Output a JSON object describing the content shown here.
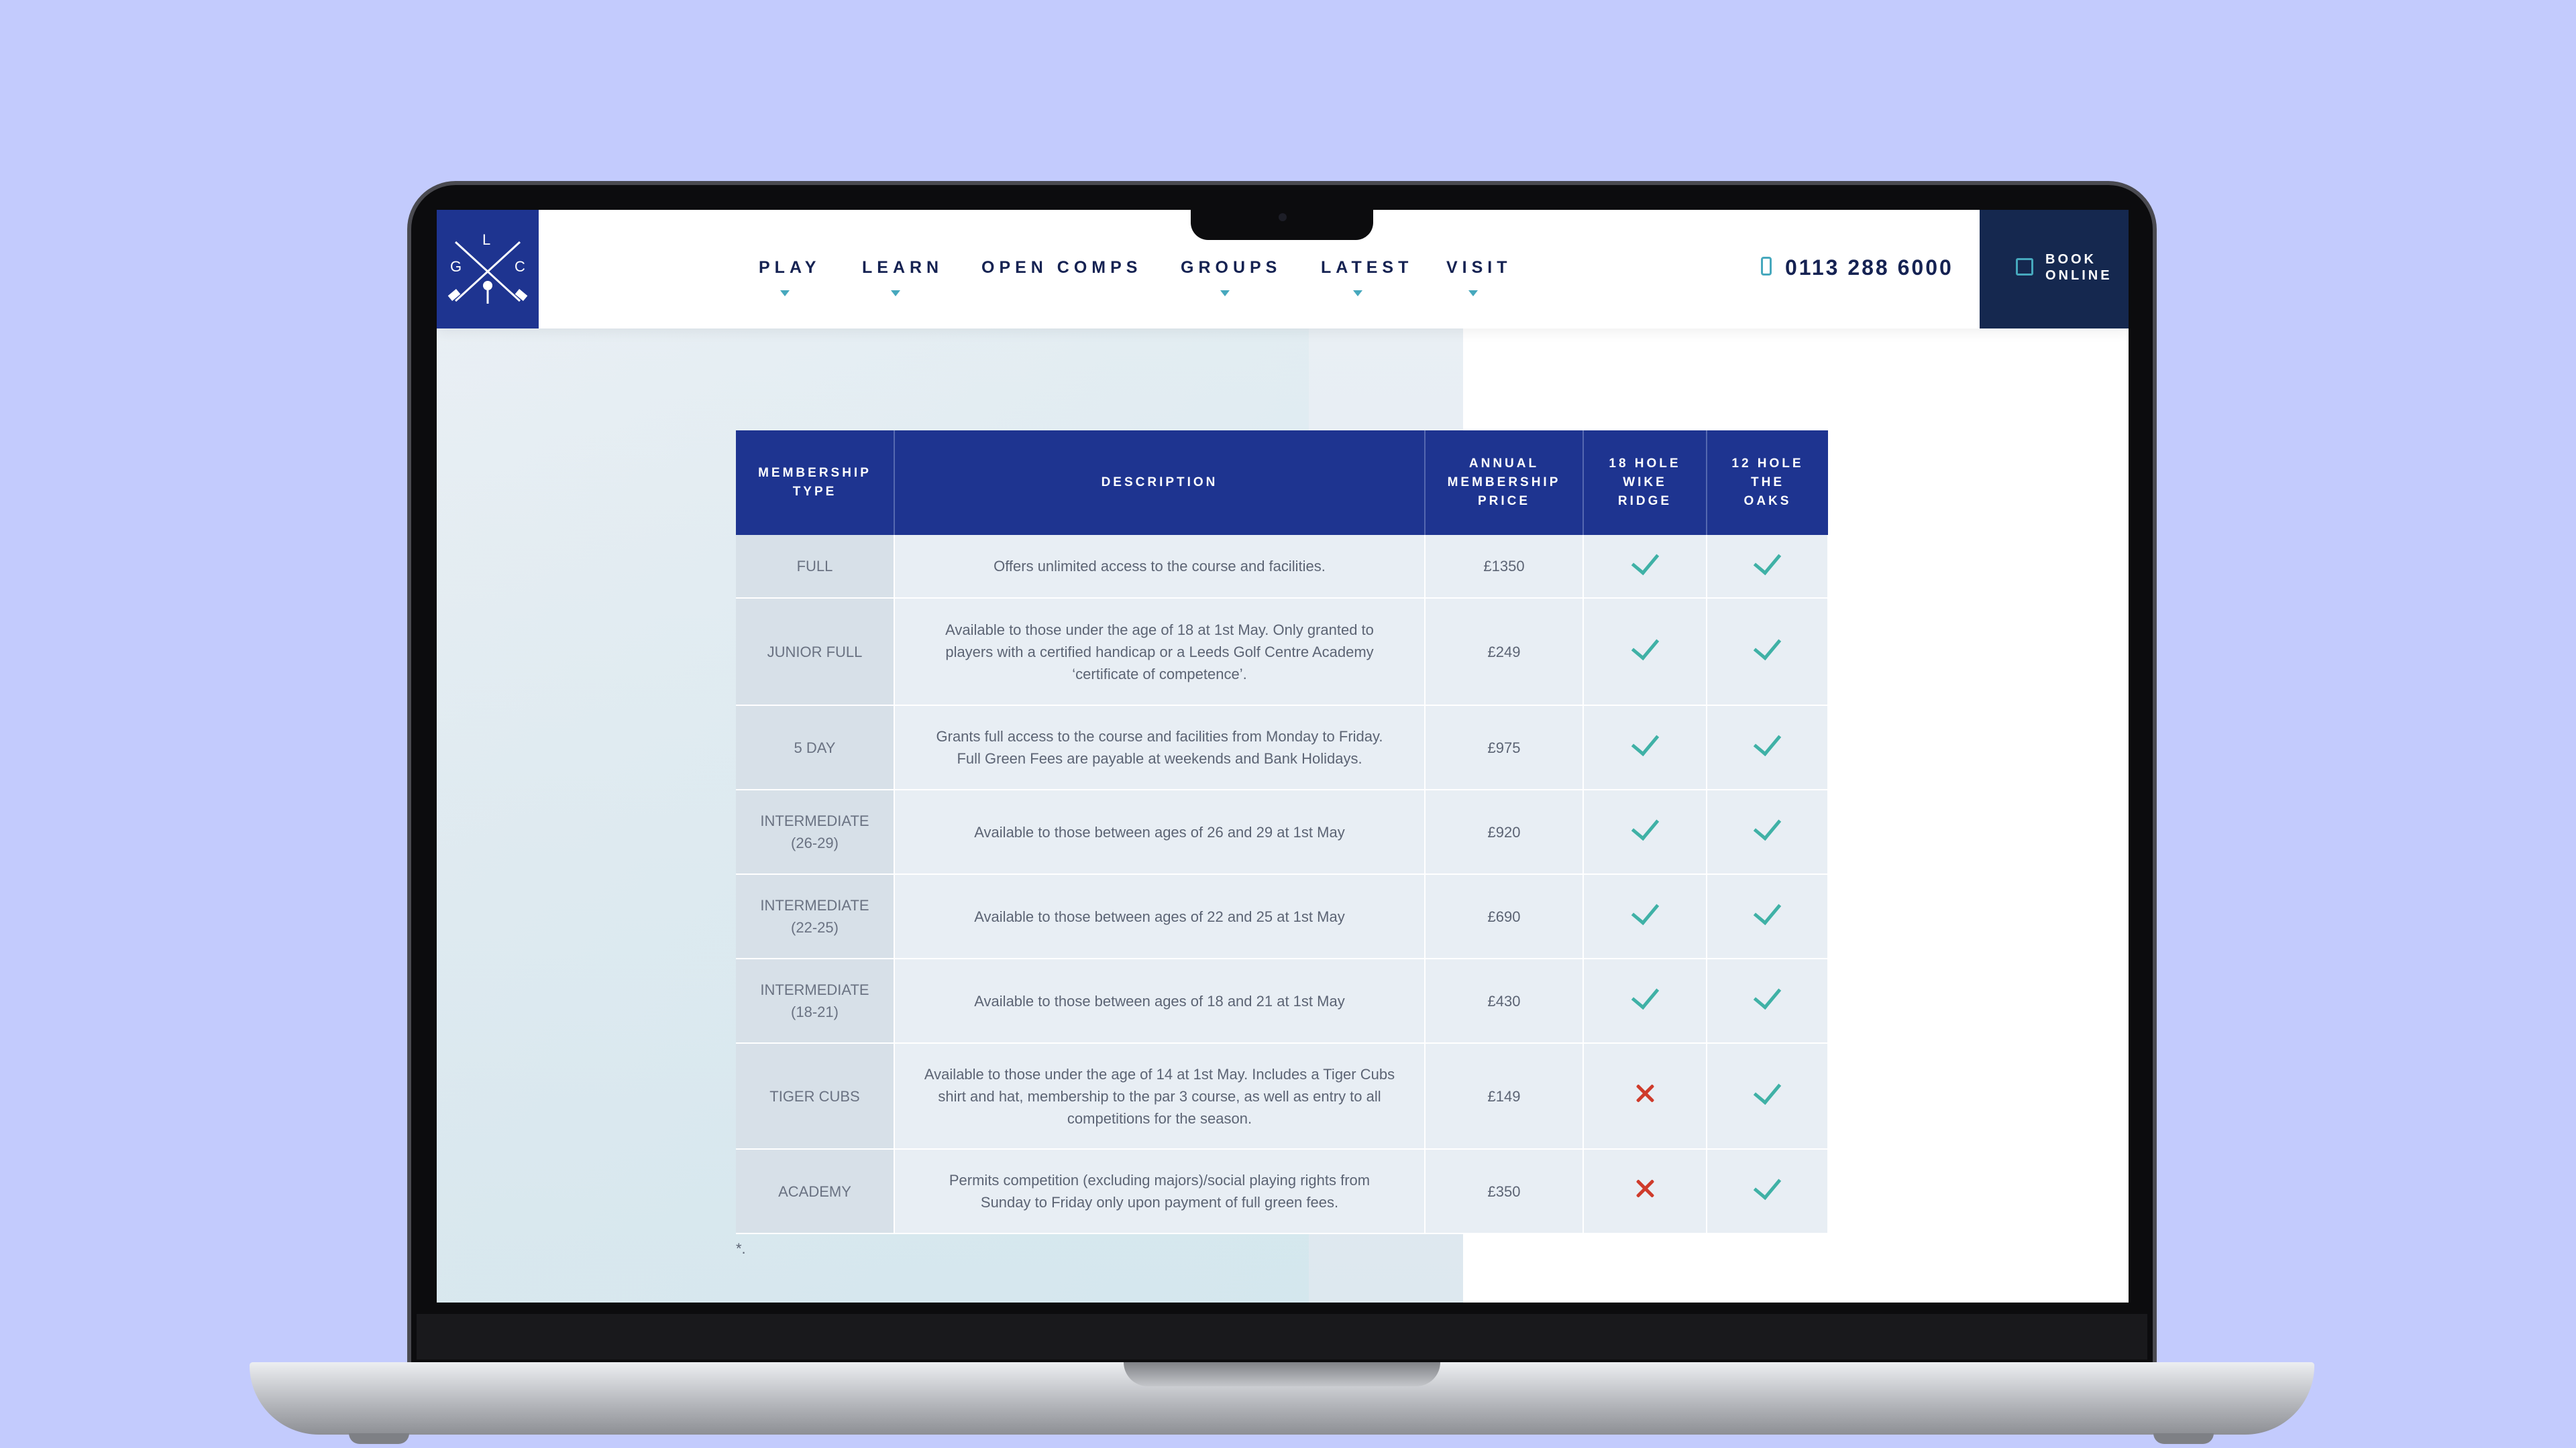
{
  "logo": {
    "letters": [
      "L",
      "G",
      "C"
    ]
  },
  "nav": [
    {
      "label": "PLAY",
      "has_menu": true
    },
    {
      "label": "LEARN",
      "has_menu": true
    },
    {
      "label": "OPEN COMPS",
      "has_menu": false
    },
    {
      "label": "GROUPS",
      "has_menu": true
    },
    {
      "label": "LATEST",
      "has_menu": true
    },
    {
      "label": "VISIT",
      "has_menu": true
    }
  ],
  "phone": {
    "number": "0113 288 6000",
    "icon": "mobile-phone-icon"
  },
  "book": {
    "line1": "BOOK",
    "line2": "ONLINE",
    "icon": "calendar-icon"
  },
  "table": {
    "headers": {
      "type": [
        "MEMBERSHIP",
        "TYPE"
      ],
      "desc": [
        "DESCRIPTION"
      ],
      "price": [
        "ANNUAL",
        "MEMBERSHIP",
        "PRICE"
      ],
      "h18": [
        "18 HOLE",
        "WIKE",
        "RIDGE"
      ],
      "h12": [
        "12 HOLE",
        "THE",
        "OAKS"
      ]
    },
    "rows": [
      {
        "type": [
          "FULL"
        ],
        "desc": [
          "Offers unlimited access to the course and facilities."
        ],
        "price": "£1350",
        "h18": true,
        "h12": true
      },
      {
        "type": [
          "JUNIOR FULL"
        ],
        "desc": [
          "Available to those under the age of 18 at 1st May. Only granted to",
          "players with a certified handicap or a Leeds Golf Centre Academy",
          "‘certificate of competence’."
        ],
        "price": "£249",
        "h18": true,
        "h12": true
      },
      {
        "type": [
          "5 DAY"
        ],
        "desc": [
          "Grants full access to the course and facilities from Monday to Friday.",
          "Full Green Fees are payable at weekends and Bank Holidays."
        ],
        "price": "£975",
        "h18": true,
        "h12": true
      },
      {
        "type": [
          "INTERMEDIATE",
          "(26-29)"
        ],
        "desc": [
          "Available to those between ages of 26 and 29 at 1st May"
        ],
        "price": "£920",
        "h18": true,
        "h12": true
      },
      {
        "type": [
          "INTERMEDIATE",
          "(22-25)"
        ],
        "desc": [
          "Available to those between ages of 22 and 25 at 1st May"
        ],
        "price": "£690",
        "h18": true,
        "h12": true
      },
      {
        "type": [
          "INTERMEDIATE",
          "(18-21)"
        ],
        "desc": [
          "Available to those between ages of 18 and 21 at 1st May"
        ],
        "price": "£430",
        "h18": true,
        "h12": true
      },
      {
        "type": [
          "TIGER CUBS"
        ],
        "desc": [
          "Available to those under the age of 14 at 1st May. Includes a Tiger Cubs",
          "shirt and hat, membership to the par 3 course, as well as entry to all",
          "competitions for the season."
        ],
        "price": "£149",
        "h18": false,
        "h12": true
      },
      {
        "type": [
          "ACADEMY"
        ],
        "desc": [
          "Permits competition (excluding majors)/social playing rights from",
          "Sunday to Friday only upon payment of full green fees."
        ],
        "price": "£350",
        "h18": false,
        "h12": true
      }
    ]
  },
  "footnote": "*.",
  "colors": {
    "navy": "#1e3490",
    "dark_navy": "#15284f",
    "teal": "#3fb1a6",
    "red": "#cf3b2b",
    "background": "#c3cbfd"
  }
}
